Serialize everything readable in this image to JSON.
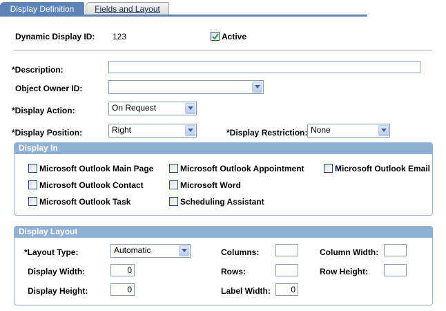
{
  "tabs": [
    {
      "label": "Display Definition",
      "active": true
    },
    {
      "label": "Fields and Layout",
      "active": false
    }
  ],
  "header": {
    "id_label": "Dynamic Display ID:",
    "id_value": "123",
    "active_label": "Active",
    "active_checked": true
  },
  "form": {
    "description_label": "*Description:",
    "description_value": "",
    "owner_label": "Object Owner ID:",
    "owner_value": "",
    "action_label": "*Display Action:",
    "action_value": "On Request",
    "position_label": "*Display Position:",
    "position_value": "Right",
    "restriction_label": "*Display Restriction:",
    "restriction_value": "None"
  },
  "display_in": {
    "title": "Display In",
    "options": [
      {
        "label": "Microsoft Outlook Main Page",
        "checked": false
      },
      {
        "label": "Microsoft Outlook Appointment",
        "checked": false
      },
      {
        "label": "Microsoft Outlook Email",
        "checked": false
      },
      {
        "label": "Microsoft Outlook Contact",
        "checked": false
      },
      {
        "label": "Microsoft Word",
        "checked": false
      },
      {
        "label": "Microsoft Outlook Task",
        "checked": false
      },
      {
        "label": "Scheduling Assistant",
        "checked": false
      }
    ]
  },
  "display_layout": {
    "title": "Display Layout",
    "layout_type_label": "*Layout Type:",
    "layout_type_value": "Automatic",
    "display_width_label": "Display Width:",
    "display_width_value": "0",
    "display_height_label": "Display Height:",
    "display_height_value": "0",
    "columns_label": "Columns:",
    "columns_value": "",
    "rows_label": "Rows:",
    "rows_value": "",
    "label_width_label": "Label Width:",
    "label_width_value": "0",
    "column_width_label": "Column Width:",
    "column_width_value": "",
    "row_height_label": "Row Height:",
    "row_height_value": ""
  },
  "colors": {
    "tab_active": "#5d84b6",
    "group_header": "#8fb0d6",
    "field_border": "#7f9db9",
    "check_mark": "#21a121"
  }
}
